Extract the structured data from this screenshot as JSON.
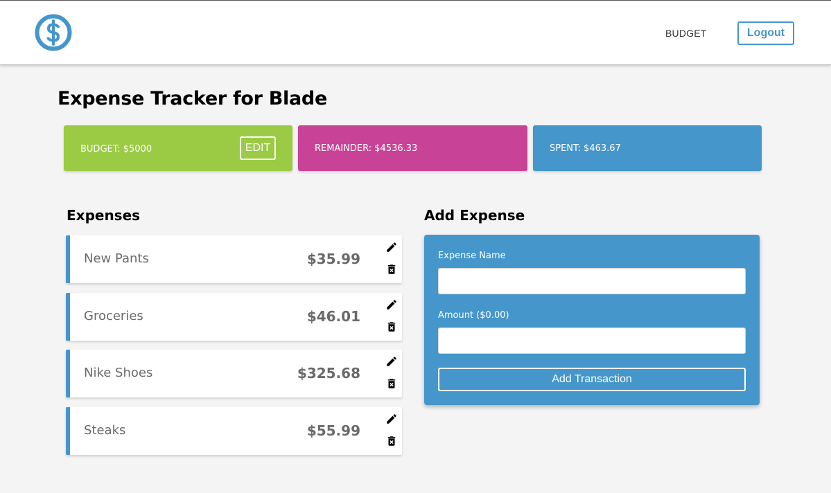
{
  "header": {
    "logo_icon": "dollar-circle-icon",
    "nav_budget": "BUDGET",
    "logout_label": "Logout"
  },
  "page_title": "Expense Tracker for Blade",
  "summary": {
    "budget": {
      "label": "BUDGET: $5000",
      "edit_label": "EDIT",
      "color": "#9bca45"
    },
    "remainder": {
      "label": "REMAINDER: $4536.33",
      "color": "#c84397"
    },
    "spent": {
      "label": "SPENT: $463.67",
      "color": "#4596cb"
    }
  },
  "expenses": {
    "title": "Expenses",
    "items": [
      {
        "name": "New Pants",
        "amount": "$35.99"
      },
      {
        "name": "Groceries",
        "amount": "$46.01"
      },
      {
        "name": "Nike Shoes",
        "amount": "$325.68"
      },
      {
        "name": "Steaks",
        "amount": "$55.99"
      }
    ],
    "edit_icon": "pencil-icon",
    "delete_icon": "trash-icon"
  },
  "add_expense": {
    "title": "Add Expense",
    "name_label": "Expense Name",
    "name_value": "",
    "amount_label": "Amount ($0.00)",
    "amount_value": "",
    "submit_label": "Add Transaction"
  },
  "colors": {
    "accent": "#4596cb",
    "background": "#f4f4f4"
  }
}
